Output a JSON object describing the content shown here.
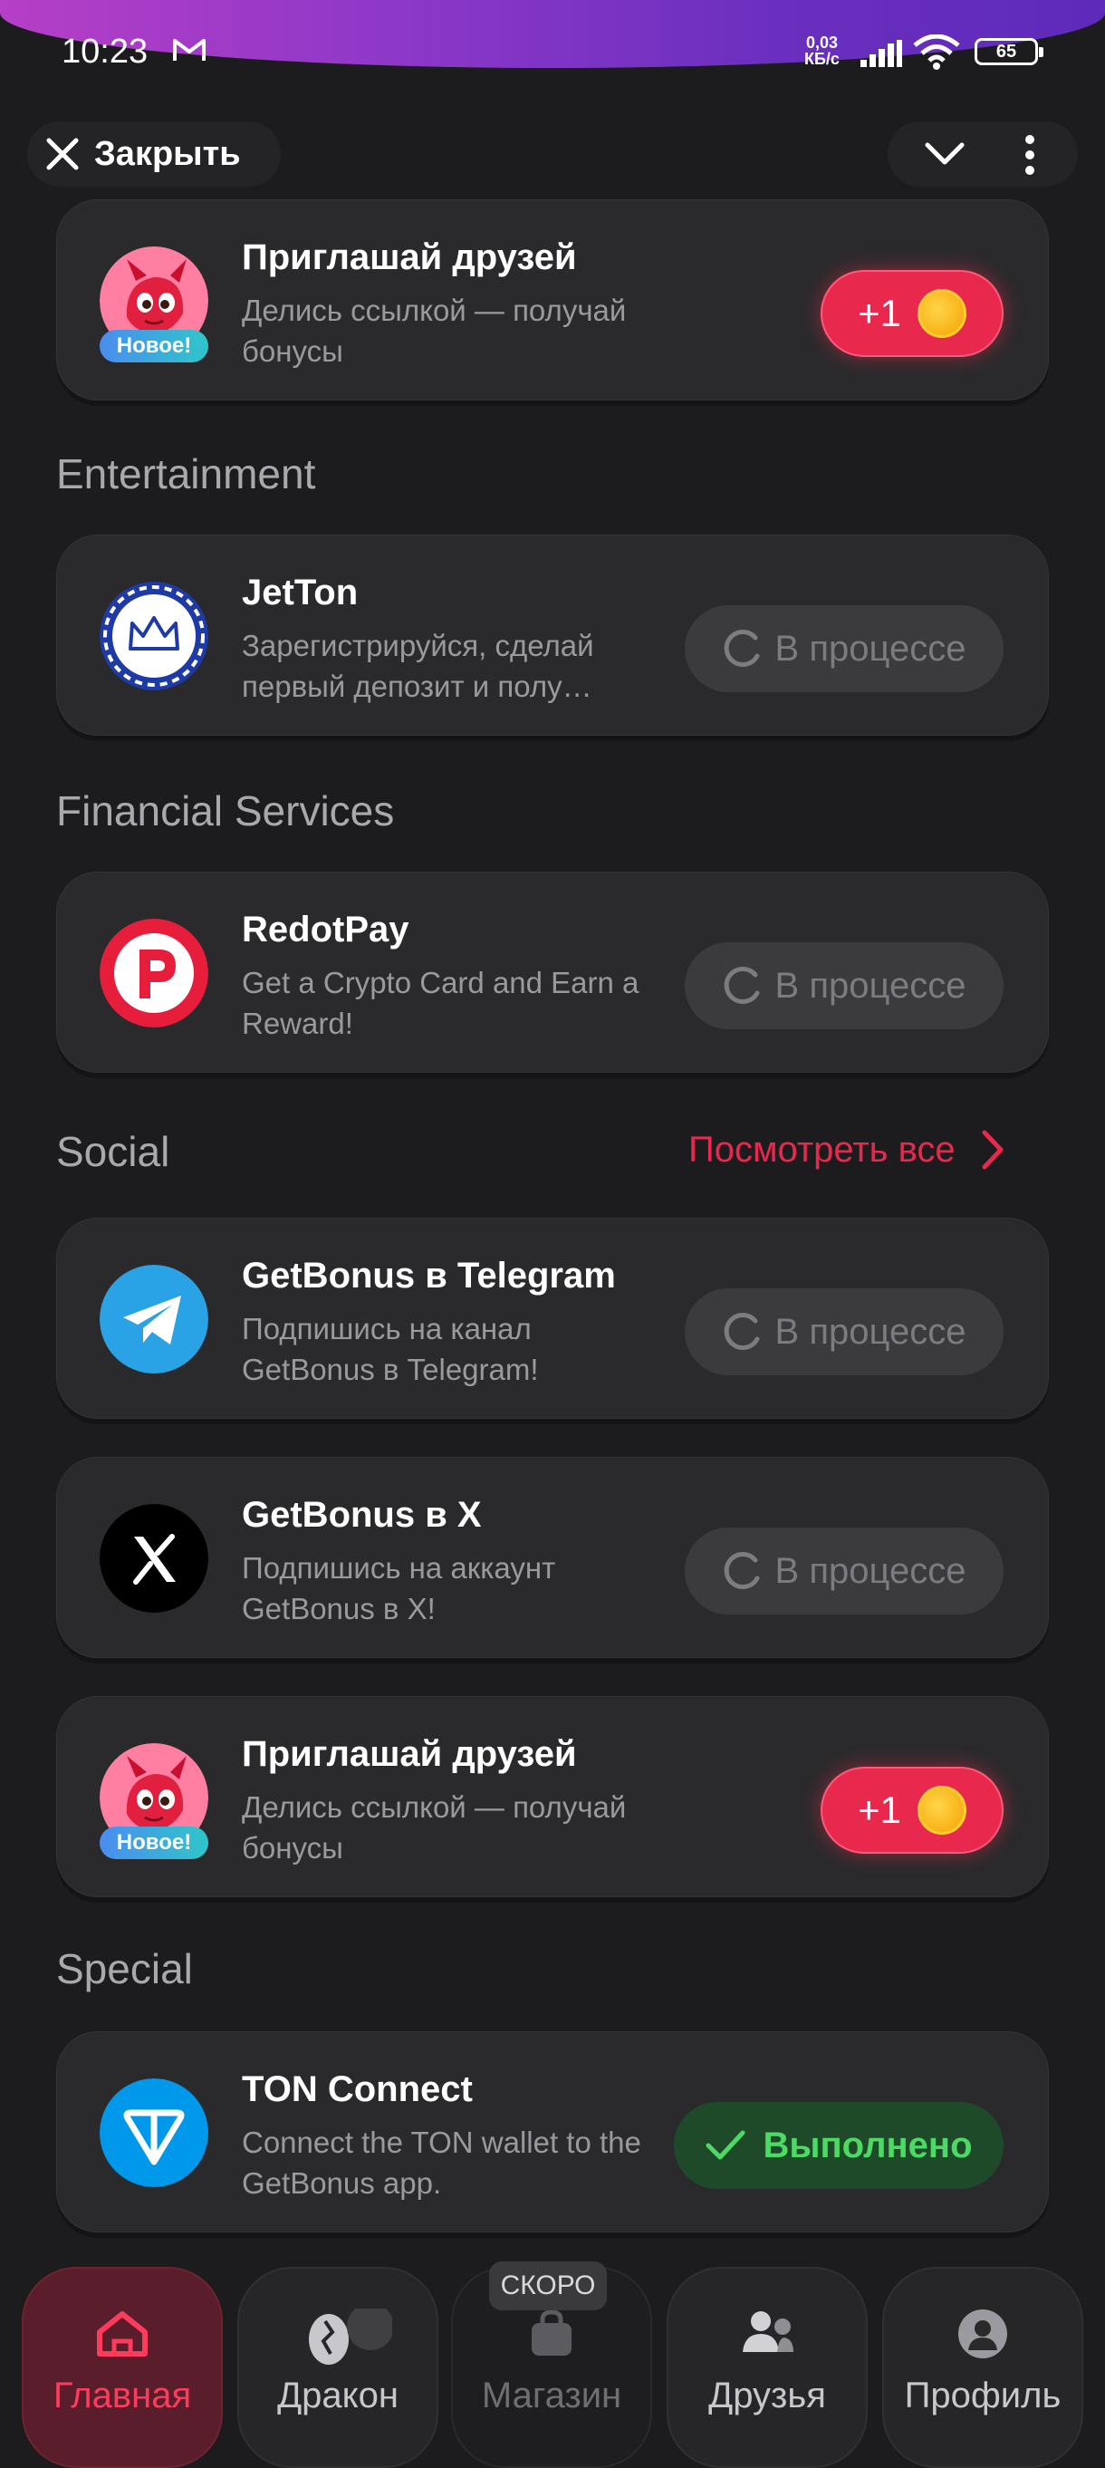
{
  "status": {
    "time": "10:23",
    "net_speed_top": "0,03",
    "net_speed_bottom": "КБ/с",
    "battery": "65"
  },
  "header": {
    "close_label": "Закрыть"
  },
  "sections": {
    "entertainment": "Entertainment",
    "financial": "Financial Services",
    "social": "Social",
    "special": "Special",
    "see_all": "Посмотреть все"
  },
  "cards": {
    "invite_top": {
      "title": "Приглашай друзей",
      "desc": "Делись ссылкой — получай бонусы",
      "badge": "Новое!",
      "reward": "+1"
    },
    "jetton": {
      "title": "JetTon",
      "desc": "Зарегистрируйся, сделай первый депозит и полу…",
      "status": "В процессе"
    },
    "redotpay": {
      "title": "RedotPay",
      "desc": "Get a Crypto Card and Earn a Reward!",
      "status": "В процессе"
    },
    "telegram": {
      "title": "GetBonus в Telegram",
      "desc": "Подпишись на канал GetBonus в Telegram!",
      "status": "В процессе"
    },
    "x": {
      "title": "GetBonus в X",
      "desc": "Подпишись на аккаунт GetBonus в X!",
      "status": "В процессе"
    },
    "invite_bottom": {
      "title": "Приглашай друзей",
      "desc": "Делись ссылкой — получай бонусы",
      "badge": "Новое!",
      "reward": "+1"
    },
    "ton": {
      "title": "TON Connect",
      "desc": "Connect the TON wallet to the GetBonus app.",
      "status": "Выполнено"
    }
  },
  "tabs": {
    "home": "Главная",
    "dragon": "Дракон",
    "shop": "Магазин",
    "friends": "Друзья",
    "profile": "Профиль",
    "soon": "СКОРО"
  },
  "colors": {
    "accent": "#e8284d",
    "done": "#4cd964",
    "background": "#1c1c1e"
  }
}
